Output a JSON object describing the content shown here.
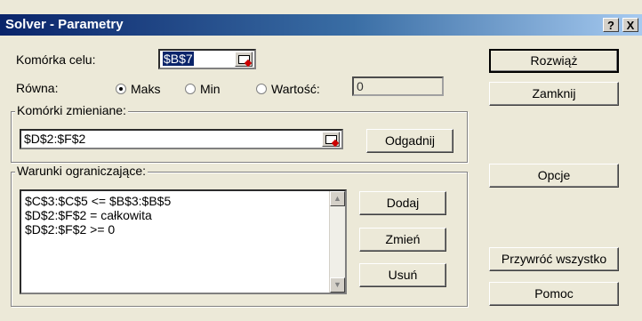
{
  "window": {
    "title": "Solver - Parametry",
    "help_label": "?",
    "close_label": "X"
  },
  "target": {
    "label": "Komórka celu:",
    "value": "$B$7"
  },
  "equal_to": {
    "label": "Równa:",
    "options": [
      {
        "label": "Maks",
        "selected": true
      },
      {
        "label": "Min",
        "selected": false
      },
      {
        "label": "Wartość:",
        "selected": false
      }
    ],
    "value_field": "0"
  },
  "changing_cells": {
    "group_label": "Komórki zmieniane:",
    "value": "$D$2:$F$2",
    "guess_button": "Odgadnij"
  },
  "constraints": {
    "group_label": "Warunki ograniczające:",
    "items": [
      "$C$3:$C$5 <= $B$3:$B$5",
      "$D$2:$F$2 = całkowita",
      "$D$2:$F$2 >= 0"
    ],
    "add_button": "Dodaj",
    "change_button": "Zmień",
    "delete_button": "Usuń"
  },
  "side_buttons": {
    "solve": "Rozwiąż",
    "close": "Zamknij",
    "options": "Opcje",
    "reset": "Przywróć wszystko",
    "help": "Pomoc"
  }
}
